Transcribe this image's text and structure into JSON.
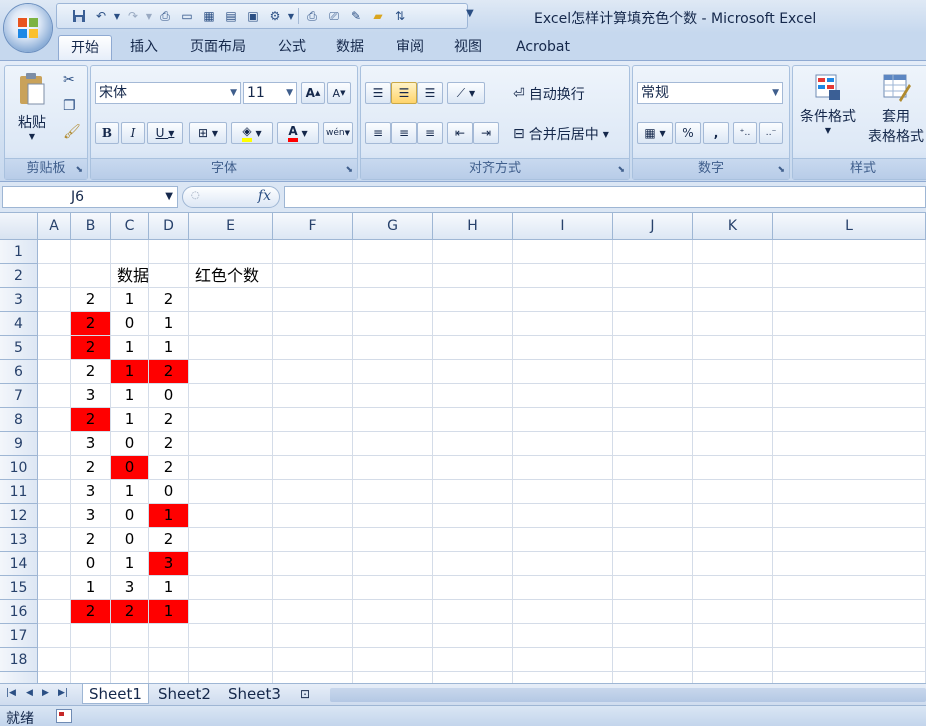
{
  "window": {
    "title": "Excel怎样计算填充色个数 - Microsoft Excel"
  },
  "ribbon": {
    "tabs": [
      "开始",
      "插入",
      "页面布局",
      "公式",
      "数据",
      "审阅",
      "视图",
      "Acrobat"
    ],
    "active_tab": "开始",
    "clipboard": {
      "label": "剪贴板",
      "paste": "粘贴"
    },
    "font": {
      "label": "字体",
      "family": "宋体",
      "size": "11",
      "grow": "A",
      "shrink": "A",
      "bold": "B",
      "italic": "I",
      "underline": "U",
      "font_color_letter": "A",
      "phonetic": "wén"
    },
    "alignment": {
      "label": "对齐方式",
      "wrap_text": "自动换行",
      "merge_center": "合并后居中"
    },
    "number": {
      "label": "数字",
      "format": "常规",
      "percent": "%",
      "comma": ","
    },
    "styles": {
      "label": "样式",
      "conditional_format": "条件格式",
      "table_format_line1": "套用",
      "table_format_line2": "表格格式"
    }
  },
  "formula_bar": {
    "name_box": "J6",
    "fx": "fx",
    "formula": ""
  },
  "sheet": {
    "columns": [
      "A",
      "B",
      "C",
      "D",
      "E",
      "F",
      "G",
      "H",
      "I",
      "J",
      "K",
      "L"
    ],
    "rows": [
      "1",
      "2",
      "3",
      "4",
      "5",
      "6",
      "7",
      "8",
      "9",
      "10",
      "11",
      "12",
      "13",
      "14",
      "15",
      "16",
      "17",
      "18"
    ],
    "header_data": "数据",
    "header_red_count": "红色个数",
    "data": [
      [
        2,
        1,
        2
      ],
      [
        2,
        0,
        1
      ],
      [
        2,
        1,
        1
      ],
      [
        2,
        1,
        2
      ],
      [
        3,
        1,
        0
      ],
      [
        2,
        1,
        2
      ],
      [
        3,
        0,
        2
      ],
      [
        2,
        0,
        2
      ],
      [
        3,
        1,
        0
      ],
      [
        3,
        0,
        1
      ],
      [
        2,
        0,
        2
      ],
      [
        0,
        1,
        3
      ],
      [
        1,
        3,
        1
      ],
      [
        2,
        2,
        1
      ]
    ],
    "red_fill": [
      [
        false,
        false,
        false
      ],
      [
        true,
        false,
        false
      ],
      [
        true,
        false,
        false
      ],
      [
        false,
        true,
        true
      ],
      [
        false,
        false,
        false
      ],
      [
        true,
        false,
        false
      ],
      [
        false,
        false,
        false
      ],
      [
        false,
        true,
        false
      ],
      [
        false,
        false,
        false
      ],
      [
        false,
        false,
        true
      ],
      [
        false,
        false,
        false
      ],
      [
        false,
        false,
        true
      ],
      [
        false,
        false,
        false
      ],
      [
        true,
        true,
        true
      ]
    ],
    "fill_color": "#ff0000"
  },
  "sheet_tabs": [
    "Sheet1",
    "Sheet2",
    "Sheet3"
  ],
  "active_sheet": "Sheet1",
  "status": {
    "text": "就绪"
  }
}
